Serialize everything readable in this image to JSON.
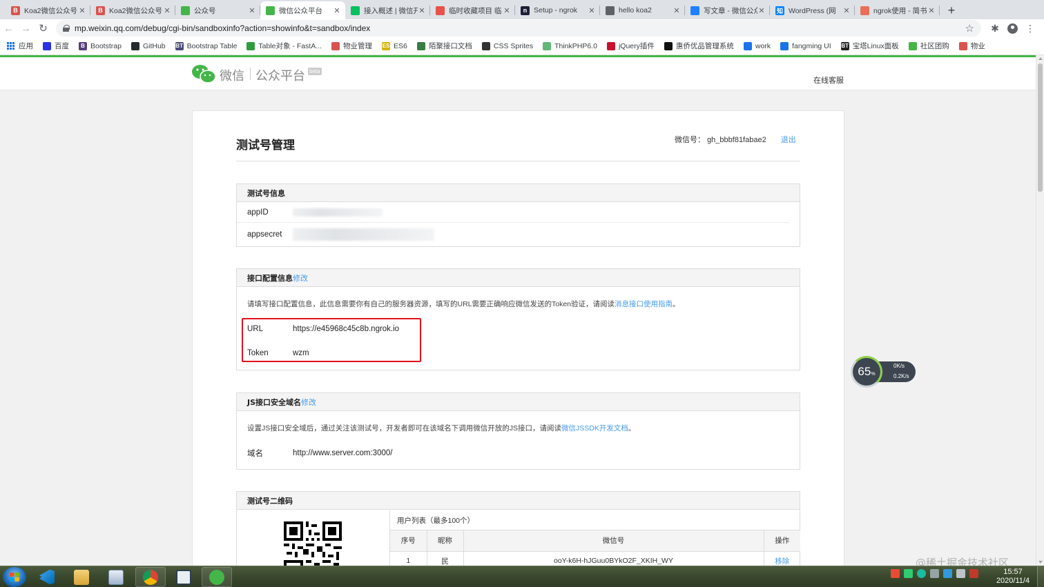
{
  "browser": {
    "tabs": [
      {
        "title": "Koa2微信公众号",
        "favicon_color": "#d9534f",
        "favicon_glyph": "B",
        "active": false
      },
      {
        "title": "Koa2微信公众号",
        "favicon_color": "#d9534f",
        "favicon_glyph": "B",
        "active": false
      },
      {
        "title": "公众号",
        "favicon_color": "#44b549",
        "favicon_glyph": "",
        "active": false
      },
      {
        "title": "微信公众平台",
        "favicon_color": "#44b549",
        "favicon_glyph": "",
        "active": true
      },
      {
        "title": "接入概述 | 微信开",
        "favicon_color": "#07c160",
        "favicon_glyph": "",
        "active": false
      },
      {
        "title": "临时收藏项目 临",
        "favicon_color": "#e8524a",
        "favicon_glyph": "",
        "active": false
      },
      {
        "title": "Setup - ngrok",
        "favicon_color": "#1f1e37",
        "favicon_glyph": "n",
        "active": false
      },
      {
        "title": "hello koa2",
        "favicon_color": "#5f6368",
        "favicon_glyph": "",
        "active": false
      },
      {
        "title": "写文章 - 微信公众",
        "favicon_color": "#1e80ff",
        "favicon_glyph": "",
        "active": false
      },
      {
        "title": "WordPress (网",
        "favicon_color": "#0084ff",
        "favicon_glyph": "知",
        "active": false
      },
      {
        "title": "ngrok使用 - 简书",
        "favicon_color": "#ea6f5a",
        "favicon_glyph": "",
        "active": false
      }
    ],
    "url": "mp.weixin.qq.com/debug/cgi-bin/sandboxinfo?action=showinfo&t=sandbox/index",
    "bookmarks": [
      {
        "label": "应用",
        "color": "#1a73e8",
        "glyph": ""
      },
      {
        "label": "百度",
        "color": "#2932e1",
        "glyph": ""
      },
      {
        "label": "Bootstrap",
        "color": "#563d7c",
        "glyph": "B"
      },
      {
        "label": "GitHub",
        "color": "#24292e",
        "glyph": ""
      },
      {
        "label": "Bootstrap Table",
        "color": "#4a4a7a",
        "glyph": "BT"
      },
      {
        "label": "Table对象 - FastA...",
        "color": "#2d9c3c",
        "glyph": ""
      },
      {
        "label": "物业管理",
        "color": "#d9534f",
        "glyph": ""
      },
      {
        "label": "ES6",
        "color": "#d4b106",
        "glyph": "ES"
      },
      {
        "label": "陌聚接口文档",
        "color": "#3a7d44",
        "glyph": ""
      },
      {
        "label": "CSS Sprites",
        "color": "#333333",
        "glyph": ""
      },
      {
        "label": "ThinkPHP6.0",
        "color": "#5fb878",
        "glyph": ""
      },
      {
        "label": "jQuery插件",
        "color": "#c8102e",
        "glyph": ""
      },
      {
        "label": "惠侨优品管理系统",
        "color": "#111111",
        "glyph": ""
      },
      {
        "label": "work",
        "color": "#1a73e8",
        "glyph": ""
      },
      {
        "label": "fangming UI",
        "color": "#1a73e8",
        "glyph": ""
      },
      {
        "label": "宝塔Linux面板",
        "color": "#222222",
        "glyph": "BT"
      },
      {
        "label": "社区团购",
        "color": "#44b549",
        "glyph": ""
      },
      {
        "label": "物业",
        "color": "#d9534f",
        "glyph": ""
      }
    ]
  },
  "header": {
    "brand_name": "微信",
    "platform": "公众平台",
    "beta": "beta",
    "service": "在线客服"
  },
  "page": {
    "title": "测试号管理",
    "account_label": "微信号：",
    "account_value": "gh_bbbf81fabae2",
    "logout": "退出"
  },
  "test_info": {
    "title": "测试号信息",
    "appid_label": "appID",
    "appsecret_label": "appsecret"
  },
  "interface_config": {
    "title": "接口配置信息",
    "edit": "修改",
    "desc": "请填写接口配置信息，此信息需要你有自己的服务器资源，填写的URL需要正确响应微信发送的Token验证，请阅读",
    "desc_link": "消息接口使用指南",
    "desc_end": "。",
    "url_label": "URL",
    "url_value": "https://e45968c45c8b.ngrok.io",
    "token_label": "Token",
    "token_value": "wzm"
  },
  "js_domain": {
    "title": "JS接口安全域名",
    "edit": "修改",
    "desc": "设置JS接口安全域后，通过关注该测试号，开发者即可在该域名下调用微信开放的JS接口，请阅读",
    "desc_link": "微信JSSDK开发文档",
    "desc_end": "。",
    "domain_label": "域名",
    "domain_value": "http://www.server.com:3000/"
  },
  "qrcode": {
    "title": "测试号二维码",
    "user_list_title": "用户列表（最多100个）",
    "columns": [
      "序号",
      "昵称",
      "微信号",
      "操作"
    ],
    "rows": [
      {
        "index": "1",
        "nickname": "民",
        "wechat_id": "ooY-k6H-hJGuu0BYkO2F_XKIH_WY",
        "action": "移除"
      }
    ]
  },
  "speed_widget": {
    "percent": "65",
    "unit": "%",
    "up": "0K/s",
    "down": "0.2K/s",
    "ring_color": "#8fd14f"
  },
  "watermark": "@稀土掘金技术社区",
  "taskbar": {
    "time": "15:57",
    "date": "2020/11/4"
  },
  "colors": {
    "wechat_green": "#44b549",
    "link_blue": "#459ae9",
    "highlight_red": "#e0121a"
  }
}
